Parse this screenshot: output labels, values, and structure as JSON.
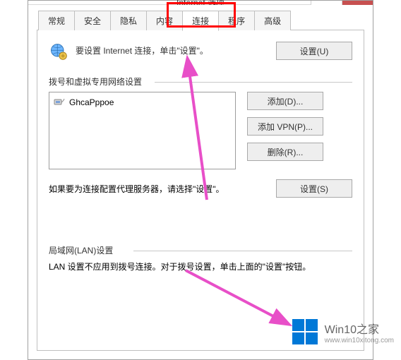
{
  "titlebar": {
    "title": "Internet 选项",
    "help_label": "?",
    "close_label": "×"
  },
  "tabs": [
    {
      "label": "常规"
    },
    {
      "label": "安全"
    },
    {
      "label": "隐私"
    },
    {
      "label": "内容"
    },
    {
      "label": "连接",
      "active": true
    },
    {
      "label": "程序"
    },
    {
      "label": "高级"
    }
  ],
  "setup": {
    "text": "要设置 Internet 连接，单击\"设置\"。",
    "button": "设置(U)"
  },
  "dial": {
    "section_label": "拨号和虚拟专用网络设置",
    "items": [
      {
        "label": "GhcaPppoe"
      }
    ],
    "add_button": "添加(D)...",
    "add_vpn_button": "添加 VPN(P)...",
    "remove_button": "删除(R)...",
    "proxy_text": "如果要为连接配置代理服务器，请选择\"设置\"。",
    "settings_button": "设置(S)"
  },
  "lan": {
    "section_label": "局域网(LAN)设置",
    "text": "LAN 设置不应用到拨号连接。对于拨号设置，单击上面的\"设置\"按钮。"
  },
  "watermark": {
    "line1": "Win10之家",
    "line2": "www.win10xitong.com"
  },
  "colors": {
    "red": "#ff0000",
    "magenta": "#e84fc8",
    "close_bg": "#c75050",
    "win_blue": "#0078d7"
  }
}
